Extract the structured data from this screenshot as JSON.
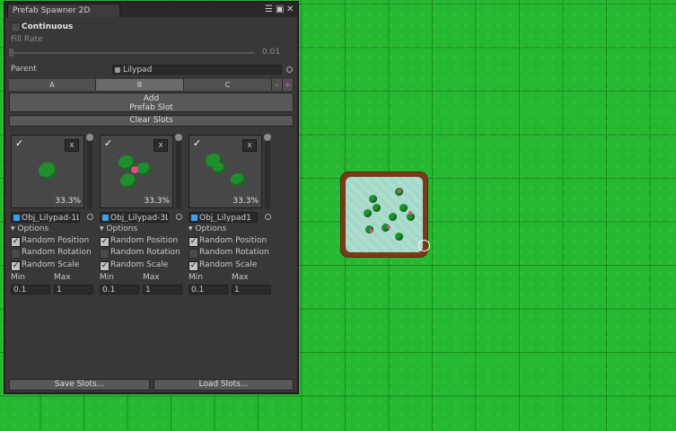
{
  "window": {
    "title": "Prefab Spawner 2D"
  },
  "continuous": {
    "label": "Continuous",
    "checked": false
  },
  "fill_rate": {
    "label": "Fill Rate",
    "value": "0.01"
  },
  "parent": {
    "label": "Parent",
    "value": "Lilypad"
  },
  "tabs": [
    {
      "label": "A"
    },
    {
      "label": "B"
    },
    {
      "label": "C"
    }
  ],
  "tab_controls": {
    "minus": "-",
    "plus": "+"
  },
  "buttons": {
    "add_prefab_line1": "Add",
    "add_prefab_line2": "Prefab Slot",
    "clear_slots": "Clear Slots",
    "save_slots": "Save Slots...",
    "load_slots": "Load Slots..."
  },
  "slots": [
    {
      "percent": "33.3%",
      "object": "Obj_Lilypad-1L",
      "options": "Options",
      "random_position": {
        "label": "Random Position",
        "checked": true
      },
      "random_rotation": {
        "label": "Random Rotation",
        "checked": false
      },
      "random_scale": {
        "label": "Random Scale",
        "checked": true
      },
      "min_label": "Min",
      "max_label": "Max",
      "min": "0.1",
      "max": "1",
      "remove": "X"
    },
    {
      "percent": "33.3%",
      "object": "Obj_Lilypad-3L",
      "options": "Options",
      "random_position": {
        "label": "Random Position",
        "checked": true
      },
      "random_rotation": {
        "label": "Random Rotation",
        "checked": false
      },
      "random_scale": {
        "label": "Random Scale",
        "checked": true
      },
      "min_label": "Min",
      "max_label": "Max",
      "min": "0.1",
      "max": "1",
      "remove": "X"
    },
    {
      "percent": "33.3%",
      "object": "Obj_Lilypad1",
      "options": "Options",
      "random_position": {
        "label": "Random Position",
        "checked": true
      },
      "random_rotation": {
        "label": "Random Rotation",
        "checked": false
      },
      "random_scale": {
        "label": "Random Scale",
        "checked": true
      },
      "min_label": "Min",
      "max_label": "Max",
      "min": "0.1",
      "max": "1",
      "remove": "X"
    }
  ],
  "colors": {
    "scene_green": "#25b830",
    "panel": "#383838",
    "accent_plus": "#e040e0",
    "pond_water": "#a4d9c9"
  }
}
